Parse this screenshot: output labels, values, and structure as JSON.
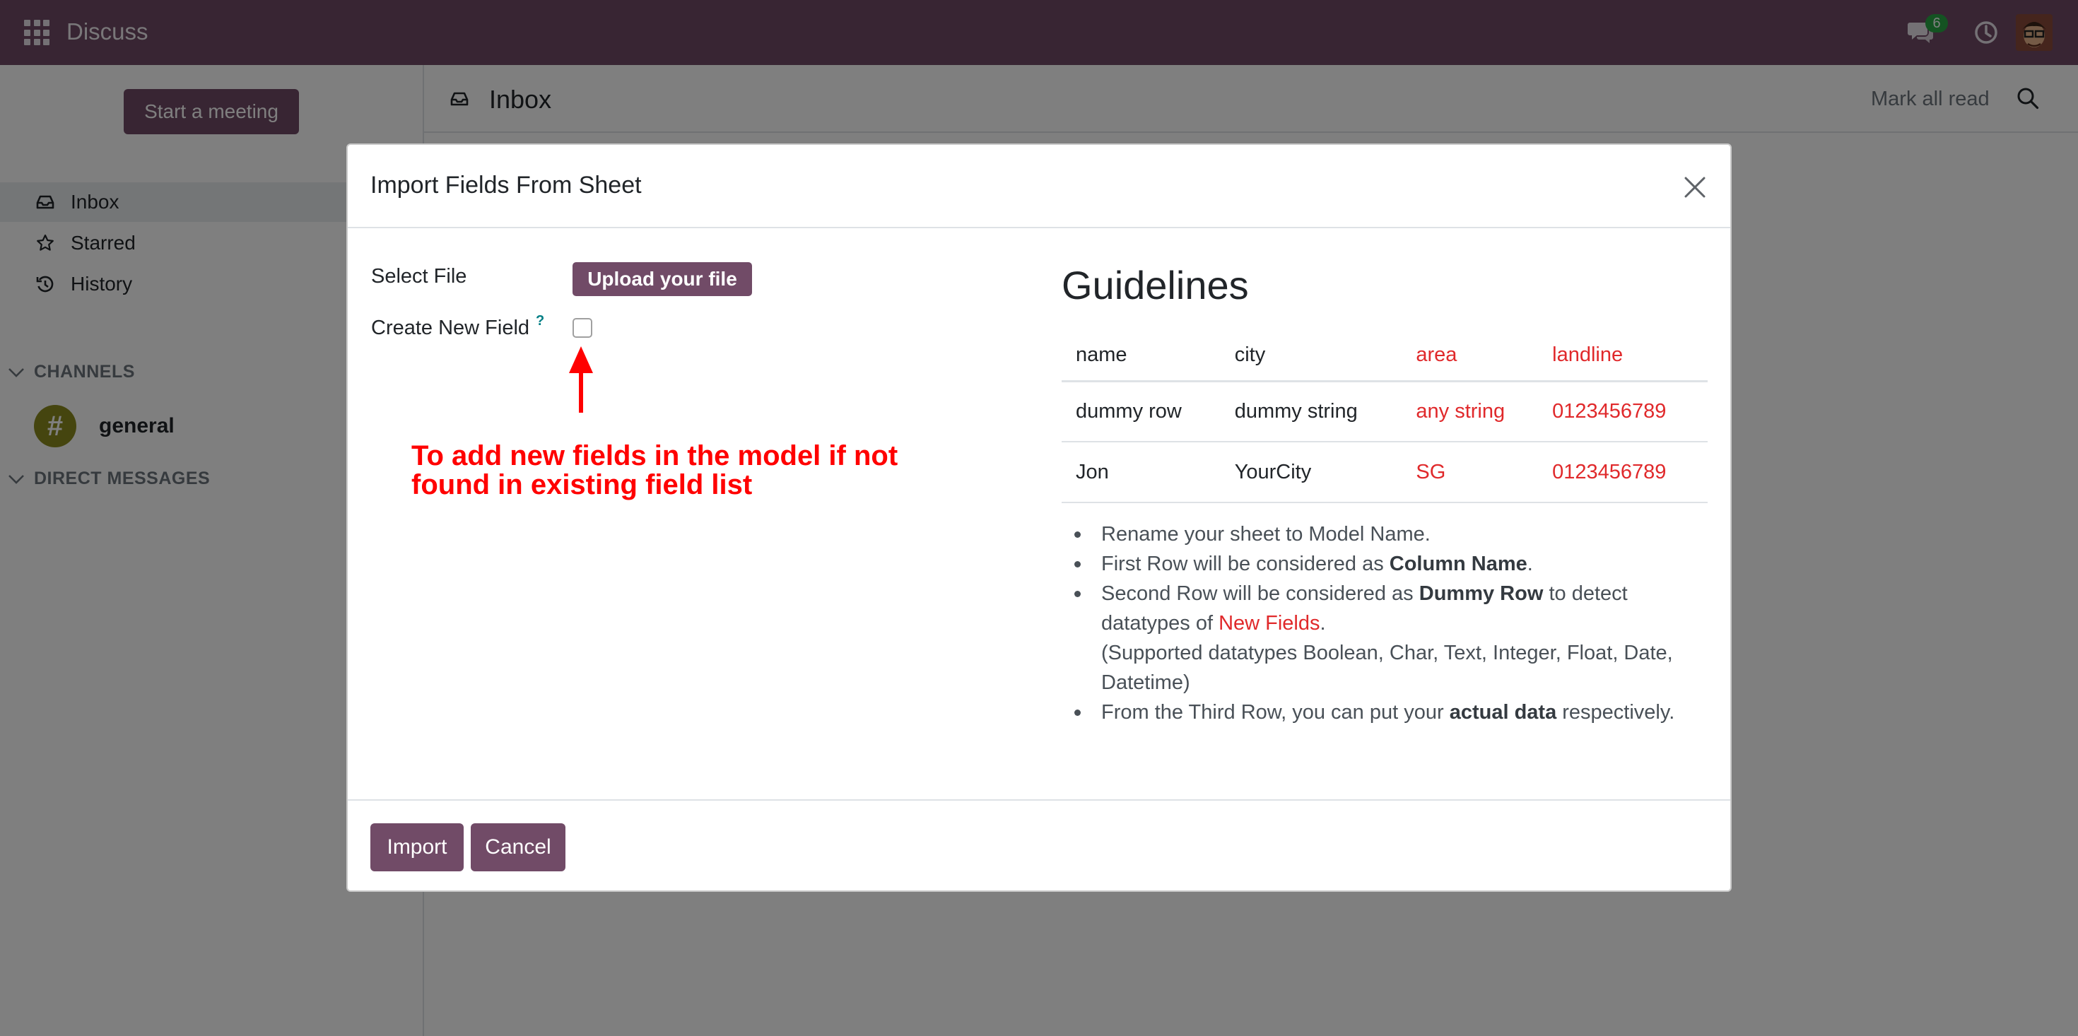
{
  "app": {
    "name": "Discuss"
  },
  "navbar": {
    "messages_count": "6"
  },
  "sidebar": {
    "start_meeting": "Start a meeting",
    "items": [
      {
        "label": "Inbox",
        "icon": "inbox-icon"
      },
      {
        "label": "Starred",
        "icon": "star-icon"
      },
      {
        "label": "History",
        "icon": "history-icon"
      }
    ],
    "channels_header": "CHANNELS",
    "channels": [
      {
        "label": "general",
        "symbol": "#"
      }
    ],
    "direct_messages_header": "DIRECT MESSAGES"
  },
  "main": {
    "title": "Inbox",
    "mark_all_read": "Mark all read"
  },
  "modal": {
    "title": "Import Fields From Sheet",
    "select_file_label": "Select File",
    "upload_button": "Upload your file",
    "create_field_label": "Create New Field",
    "help_mark": "?",
    "annotation": "To add new fields in the model if not found in existing field list",
    "guidelines_title": "Guidelines",
    "table": {
      "headers": [
        "name",
        "city",
        "area",
        "landline"
      ],
      "rows": [
        [
          "dummy row",
          "dummy string",
          "any string",
          "0123456789"
        ],
        [
          "Jon",
          "YourCity",
          "SG",
          "0123456789"
        ]
      ]
    },
    "guidelines": {
      "line1": "Rename your sheet to Model Name.",
      "line2_pre": "First Row will be considered as ",
      "line2_bold": "Column Name",
      "line2_post": ".",
      "line3_pre": "Second Row will be considered as ",
      "line3_bold": "Dummy Row",
      "line3_mid": " to detect datatypes of ",
      "line3_red": "New Fields",
      "line3_post": ".",
      "line3_note": "(Supported datatypes Boolean, Char, Text, Integer, Float, Date, Datetime)",
      "line4_pre": "From the Third Row, you can put your ",
      "line4_bold": "actual data",
      "line4_post": " respectively."
    },
    "import_button": "Import",
    "cancel_button": "Cancel"
  },
  "colors": {
    "brand": "#714B67",
    "accent_red": "#e0292b",
    "annotation_red": "#ff0000",
    "badge_green": "#28a745"
  }
}
